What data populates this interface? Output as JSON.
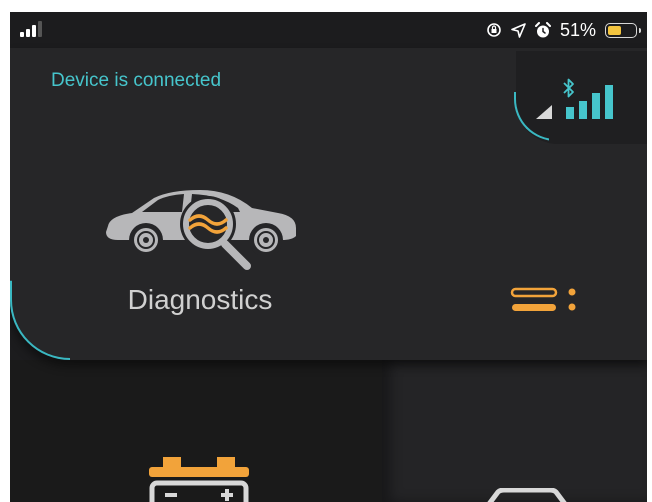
{
  "status_bar": {
    "battery_percent": "51%",
    "battery_level": 0.51,
    "icons": [
      "cellular-signal-icon",
      "orientation-lock-icon",
      "location-icon",
      "alarm-icon",
      "battery-icon"
    ]
  },
  "connection": {
    "status_text": "Device is connected",
    "icons": [
      "bluetooth-icon",
      "signal-strength-icon"
    ]
  },
  "main_card": {
    "label": "Diagnostics",
    "icon": "car-diagnostics-icon"
  },
  "menu": {
    "icon": "menu-icon"
  },
  "tiles": [
    {
      "icon": "car-battery-icon"
    },
    {
      "icon": "car-front-icon"
    }
  ],
  "colors": {
    "accent_teal": "#46c5cc",
    "accent_orange": "#f2a33a",
    "background": "#1c1c1e",
    "card": "#262628"
  }
}
